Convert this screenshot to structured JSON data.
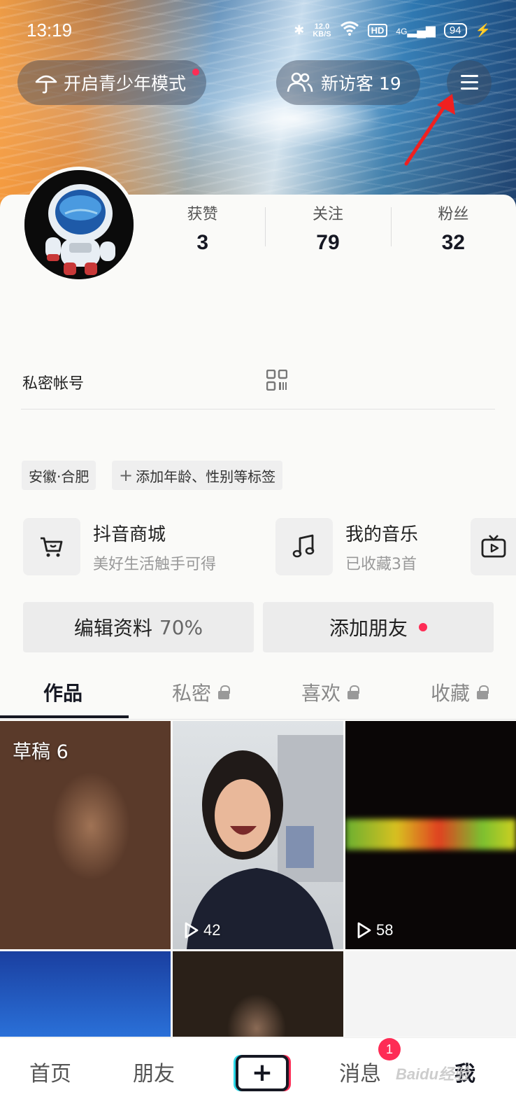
{
  "status_bar": {
    "time": "13:19",
    "net_speed": "12.0",
    "net_speed_unit": "KB/S",
    "hd": "HD",
    "signal": "4G",
    "battery": "94"
  },
  "header": {
    "teen_mode_label": "开启青少年模式",
    "visitors_label": "新访客 19",
    "menu_icon": "hamburger-menu-icon"
  },
  "profile": {
    "stats": [
      {
        "label": "获赞",
        "value": "3"
      },
      {
        "label": "关注",
        "value": "79"
      },
      {
        "label": "粉丝",
        "value": "32"
      }
    ],
    "account_status": "私密帐号",
    "tags": {
      "location": "安徽·合肥",
      "add_tags": "添加年龄、性别等标签"
    }
  },
  "tiles": [
    {
      "title": "抖音商城",
      "subtitle": "美好生活触手可得",
      "icon": "cart-icon"
    },
    {
      "title": "我的音乐",
      "subtitle": "已收藏3首",
      "icon": "music-note-icon"
    }
  ],
  "buttons": {
    "edit_profile": "编辑资料",
    "edit_percent": "70%",
    "add_friends": "添加朋友"
  },
  "tabs": [
    {
      "label": "作品",
      "active": true
    },
    {
      "label": "私密",
      "locked": true
    },
    {
      "label": "喜欢",
      "locked": true
    },
    {
      "label": "收藏",
      "locked": true
    }
  ],
  "videos": [
    {
      "label": "草稿 6"
    },
    {
      "plays": "42"
    },
    {
      "plays": "58"
    }
  ],
  "bottom_nav": {
    "home": "首页",
    "friends": "朋友",
    "messages": "消息",
    "messages_badge": "1",
    "me": "我"
  },
  "watermark": "Baidu经验",
  "colors": {
    "accent": "#fe2c55",
    "text": "#161823"
  }
}
